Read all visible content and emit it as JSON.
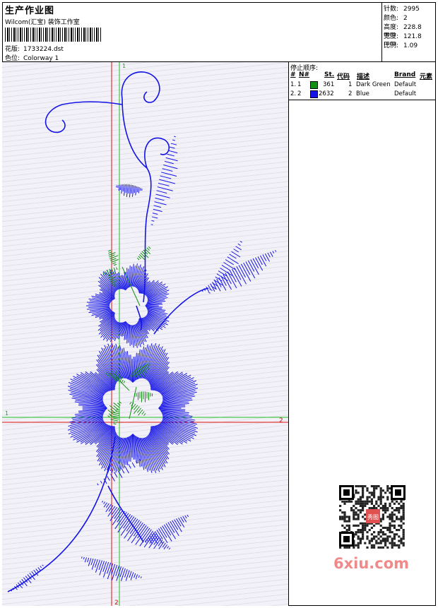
{
  "header": {
    "title": "生产作业图",
    "subtitle": "Wilcom(汇宝) 装饰工作室",
    "design_label": "花版:",
    "design_value": "1733224.dst",
    "colorway_label": "色位:",
    "colorway_value": "Colorway 1"
  },
  "specs": {
    "stitches_label": "针数:",
    "stitches_value": "2995",
    "colors_label": "颜色:",
    "colors_value": "2",
    "height_label": "高度:",
    "height_value": "228.8 mm",
    "width_label": "宽度:",
    "width_value": "121.8 mm",
    "scale_label": "比例:",
    "scale_value": "1.09"
  },
  "stop_sequence": {
    "title": "停止顺序:",
    "columns": [
      "#",
      "N#",
      "St.",
      "代码",
      "描述",
      "Brand",
      "元素"
    ],
    "rows": [
      {
        "index": "1.",
        "needle": "1",
        "color": "#139013",
        "stitches": "361",
        "code": "1",
        "description": "Dark Green",
        "brand": "Default"
      },
      {
        "index": "2.",
        "needle": "2",
        "color": "#1414e6",
        "stitches": "2632",
        "code": "2",
        "description": "Blue",
        "brand": "Default"
      }
    ]
  },
  "canvas": {
    "marker_v1_top": "1",
    "marker_h1_left": "1",
    "marker_h2_right": "2",
    "marker_v2_bottom": "2",
    "thread_colors": {
      "green": "#139013",
      "blue": "#1414e6"
    },
    "guide_colors": {
      "red": "#e01010",
      "green": "#20c020"
    }
  },
  "watermark": {
    "text": "6xiu.com",
    "badge_text": "秀图"
  }
}
